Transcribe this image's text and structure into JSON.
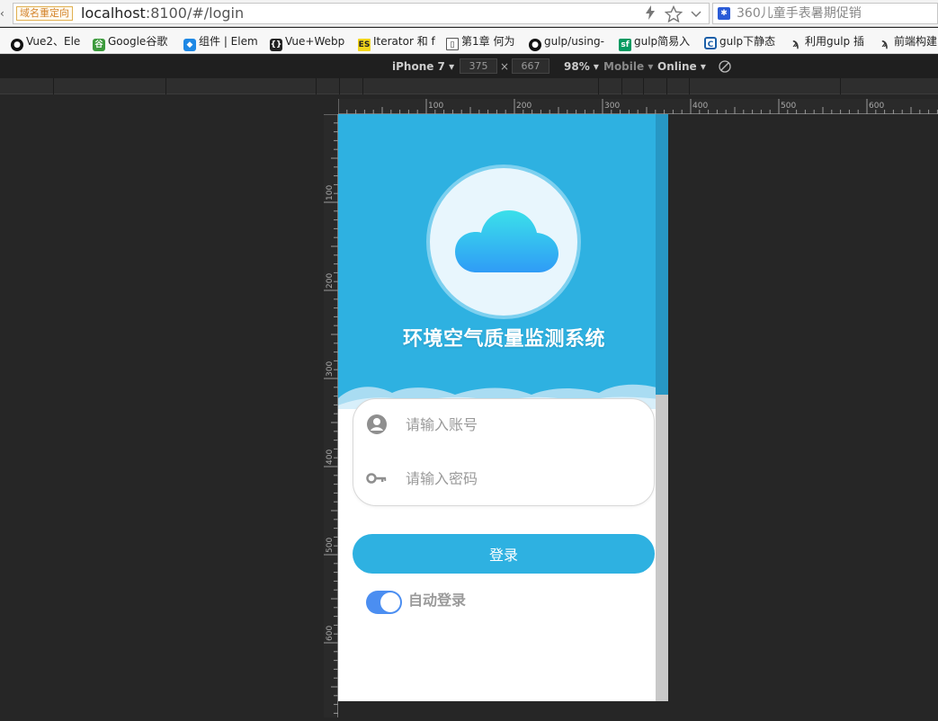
{
  "browser": {
    "redirect_tag": "域名重定向",
    "url_host": "localhost",
    "url_rest": ":8100/#/login",
    "search_text": "360儿童手表暑期促销",
    "icons": [
      "lightning-icon",
      "star-icon",
      "chevron-down-icon",
      "baidu-icon"
    ]
  },
  "bookmarks": [
    {
      "label": "Vue2、Ele",
      "icon": "github-icon"
    },
    {
      "label": "Google谷歌",
      "icon": "google-icon"
    },
    {
      "label": "组件 | Elem",
      "icon": "element-icon"
    },
    {
      "label": "Vue+Webp",
      "icon": "braces-icon"
    },
    {
      "label": "Iterator 和 f",
      "icon": "es-icon"
    },
    {
      "label": "第1章 何为",
      "icon": "book-icon"
    },
    {
      "label": "gulp/using-",
      "icon": "github-icon"
    },
    {
      "label": "gulp简易入",
      "icon": "sf-icon"
    },
    {
      "label": "gulp下静态",
      "icon": "site-icon"
    },
    {
      "label": "利用gulp 插",
      "icon": "link-icon"
    },
    {
      "label": "前端构建",
      "icon": "link-icon"
    }
  ],
  "devtools": {
    "device": "iPhone 7",
    "width": "375",
    "times": "×",
    "height": "667",
    "zoom": "98%",
    "mode": "Mobile",
    "network": "Online"
  },
  "app": {
    "title": "环境空气质量监测系统",
    "account_placeholder": "请输入账号",
    "password_placeholder": "请输入密码",
    "login_label": "登录",
    "auto_login_label": "自动登录",
    "auto_login_on": true
  },
  "colors": {
    "primary": "#2eb1e1",
    "toggle": "#4b8ef1",
    "cloud_top": "#3be0ea",
    "cloud_bottom": "#2f9cf6"
  },
  "ruler": {
    "h_labels": [
      "100",
      "200",
      "300",
      "400",
      "500",
      "600"
    ],
    "v_labels": [
      "100",
      "200",
      "300",
      "400",
      "500",
      "600"
    ]
  }
}
